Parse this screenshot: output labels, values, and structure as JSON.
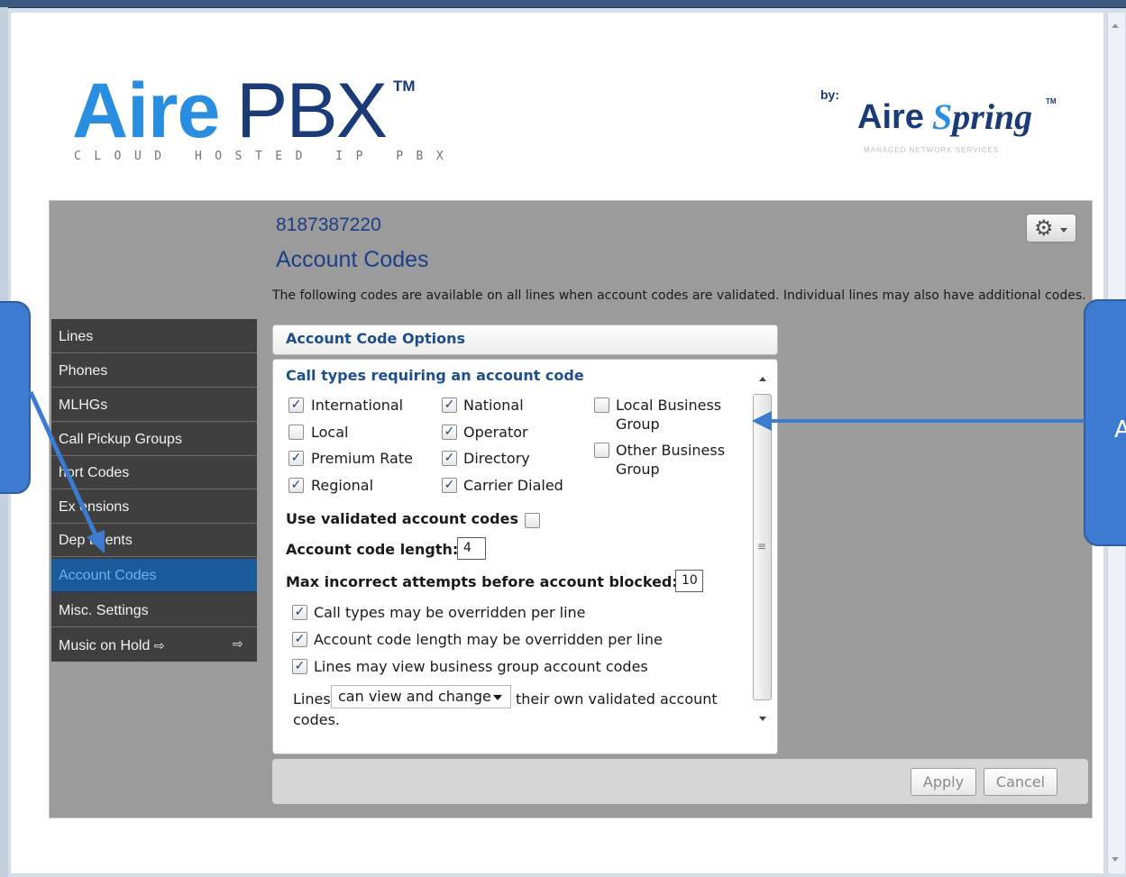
{
  "logo": {
    "main_bold": "Aire",
    "main_light": "PBX",
    "trademark": "TM",
    "tagline": "CLOUD HOSTED IP PBX",
    "by_label": "by:",
    "partner_bold": "Aire",
    "partner_spring_initial": "S",
    "partner_spring_rest": "pring",
    "partner_trademark": "TM",
    "partner_tagline": "MANAGED NETWORK SERVICES"
  },
  "header": {
    "account_number": "8187387220",
    "title": "Account Codes",
    "description": "The following codes are available on all lines when account codes are validated. Individual lines may also have additional codes."
  },
  "icons": {
    "gear": "gear-icon",
    "external_link": "external-link-icon",
    "scroll_grip": "scroll-grip-icon"
  },
  "sidebar": {
    "items": [
      {
        "label": "Lines"
      },
      {
        "label": "Phones"
      },
      {
        "label": "MLHGs"
      },
      {
        "label": "Call Pickup Groups"
      },
      {
        "label": "hort Codes"
      },
      {
        "label": "Ex  ensions"
      },
      {
        "label": "Dep   tments"
      },
      {
        "label": "Account Codes"
      },
      {
        "label": "Misc. Settings"
      },
      {
        "label": "Music on Hold"
      }
    ],
    "external_glyph": "⇨"
  },
  "options": {
    "header_title": "Account Code Options",
    "call_types_heading": "Call types requiring an account code",
    "call_types": [
      {
        "label": "International",
        "checked": true
      },
      {
        "label": "National",
        "checked": true
      },
      {
        "label": "Local Business Group",
        "line1": "Local Business",
        "line2": "Group",
        "checked": false
      },
      {
        "label": "Local",
        "checked": false
      },
      {
        "label": "Operator",
        "checked": true
      },
      {
        "label": "Other Business Group",
        "line1": "Other Business",
        "line2": "Group",
        "checked": false
      },
      {
        "label": "Premium Rate",
        "checked": true
      },
      {
        "label": "Directory",
        "checked": true
      },
      {
        "label": "Regional",
        "checked": true
      },
      {
        "label": "Carrier Dialed",
        "checked": true
      }
    ],
    "use_validated_label": "Use validated account codes",
    "use_validated_checked": false,
    "code_length_label": "Account code length:",
    "code_length_value": "4",
    "max_attempts_label": "Max incorrect attempts before account blocked:",
    "max_attempts_value": "10",
    "overrides": [
      {
        "label": "Call types may be overridden per line",
        "checked": true
      },
      {
        "label": "Account code length may be overridden per line",
        "checked": true
      },
      {
        "label": "Lines may view business group account codes",
        "checked": true
      }
    ],
    "lines_prefix": "Lines",
    "lines_select_value": "can view and change",
    "lines_suffix_1": "their own validated account",
    "lines_suffix_2": "codes."
  },
  "buttons": {
    "apply": "Apply",
    "cancel": "Cancel"
  },
  "callout_right_text": "A",
  "colors": {
    "brand_blue": "#2a8ee0",
    "brand_navy": "#1a3a78",
    "sidebar_bg": "#3f3f3f",
    "sidebar_active": "#1a5a9a",
    "callout": "#3c7bd0"
  }
}
